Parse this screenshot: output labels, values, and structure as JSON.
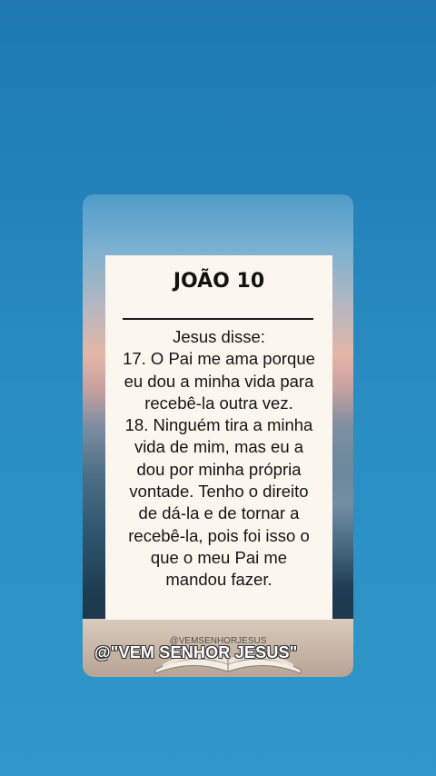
{
  "post": {
    "title": "JOÃO 10",
    "verse_lines": [
      "Jesus disse:",
      "17. O Pai me ama porque",
      "eu dou a minha vida para",
      "recebê-la outra vez.",
      "18. Ninguém tira a minha",
      "vida de mim, mas eu a",
      "dou por minha própria",
      "vontade. Tenho o direito",
      "de dá-la e de tornar a",
      "recebê-la, pois foi isso o",
      "que o meu Pai me",
      "mandou fazer."
    ],
    "watermark_small": "@VEMSENHORJESUS",
    "handle": "@\"VEM SENHOR JESUS\""
  },
  "colors": {
    "page_background": "#2a8fc4",
    "panel_background": "#fcf7ee",
    "text": "#141414"
  }
}
